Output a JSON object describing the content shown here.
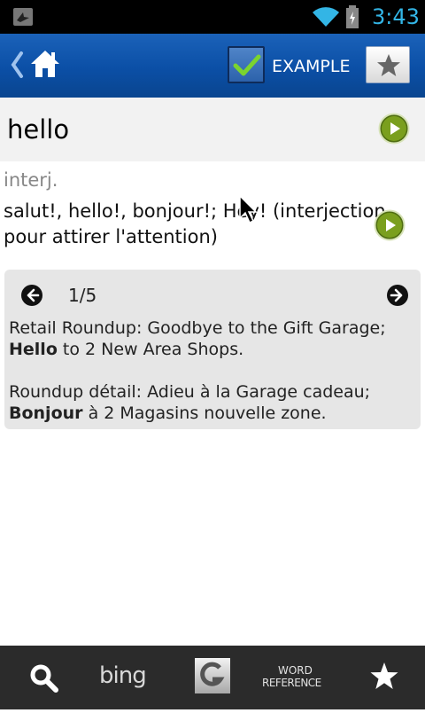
{
  "status_bar": {
    "time": "3:43"
  },
  "action_bar": {
    "example_label": "EXAMPLE",
    "example_checked": true
  },
  "entry": {
    "word": "hello",
    "part_of_speech": "interj.",
    "translation": "salut!, hello!, bonjour!; Hey! (interjection pour attirer l'attention)"
  },
  "examples": {
    "counter": "1/5",
    "source_bold": "Hello",
    "source_before": "Retail Roundup: Goodbye to the Gift Garage; ",
    "source_after": " to 2 New Area Shops.",
    "target_before": "Roundup détail: Adieu à la Garage cadeau; ",
    "target_bold": "Bonjour",
    "target_after": " à 2 Magasins nouvelle zone."
  },
  "bottom_bar": {
    "items": [
      {
        "icon": "search-icon"
      },
      {
        "label": "bing"
      },
      {
        "icon": "google-icon"
      },
      {
        "label_line1": "WORD",
        "label_line2": "REFERENCE"
      },
      {
        "icon": "star-icon"
      }
    ]
  },
  "colors": {
    "action_bar": "#0b4fa6",
    "clock": "#33b5e5",
    "play_green": "#6a8f1a",
    "bottom_bar": "#2b2b2b"
  }
}
